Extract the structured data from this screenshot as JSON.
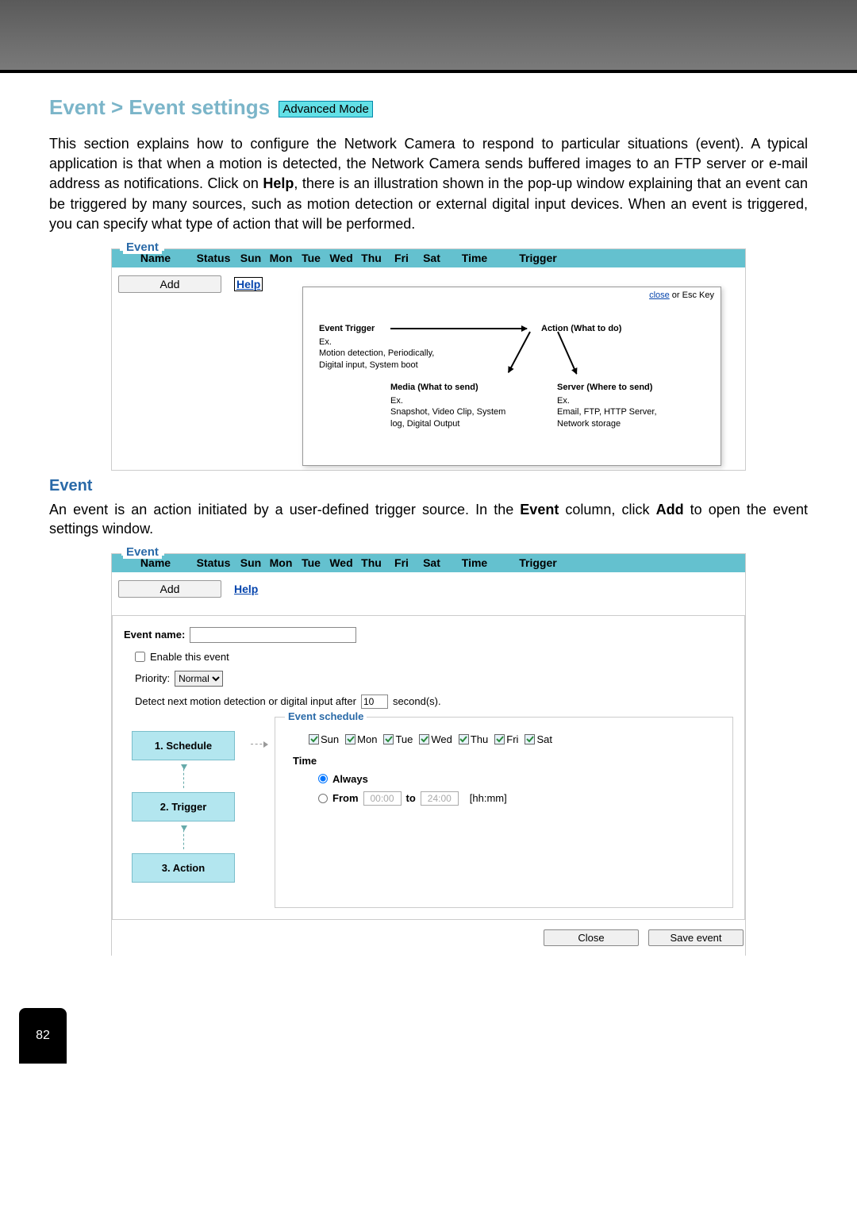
{
  "page_number": "82",
  "title_prefix": "Event > Event settings",
  "mode_badge": "Advanced Mode",
  "intro_paragraph": "This section explains how to configure the Network Camera to respond to particular situations (event). A typical application is that when a motion is detected, the Network Camera sends buffered images to an FTP server or e-mail address as notifications. Click on Help, there is an illustration shown in the pop-up window explaining that an event can be triggered by many sources, such as motion detection or external digital input devices. When an event is triggered, you can specify what type of action that will be performed.",
  "event_table": {
    "legend": "Event",
    "columns": [
      "Name",
      "Status",
      "Sun",
      "Mon",
      "Tue",
      "Wed",
      "Thu",
      "Fri",
      "Sat",
      "Time",
      "Trigger"
    ],
    "add_btn": "Add",
    "help_link": "Help"
  },
  "help_popup": {
    "close_text": "close",
    "close_suffix": " or Esc Key",
    "trigger_label": "Event Trigger",
    "trigger_ex": "Ex.\nMotion detection, Periodically,\nDigital input, System boot",
    "action_label": "Action (What to do)",
    "media_label": "Media (What to send)",
    "media_ex": "Ex.\nSnapshot, Video Clip, System\nlog, Digital Output",
    "server_label": "Server (Where to send)",
    "server_ex": "Ex.\nEmail, FTP, HTTP Server,\nNetwork storage"
  },
  "event_section_heading": "Event",
  "event_section_text": "An event is an action initiated by a user-defined trigger source. In the Event column, click Add to open the event settings window.",
  "settings": {
    "legend": "Event",
    "columns": [
      "Name",
      "Status",
      "Sun",
      "Mon",
      "Tue",
      "Wed",
      "Thu",
      "Fri",
      "Sat",
      "Time",
      "Trigger"
    ],
    "add_btn": "Add",
    "help_link": "Help",
    "event_name_label": "Event name:",
    "event_name_value": "",
    "enable_label": "Enable this event",
    "priority_label": "Priority:",
    "priority_value": "Normal",
    "detect_prefix": "Detect next motion detection or digital input after",
    "detect_value": "10",
    "detect_suffix": "second(s).",
    "steps": [
      "1.  Schedule",
      "2.  Trigger",
      "3.  Action"
    ],
    "schedule_legend": "Event schedule",
    "days": [
      "Sun",
      "Mon",
      "Tue",
      "Wed",
      "Thu",
      "Fri",
      "Sat"
    ],
    "time_label": "Time",
    "always_label": "Always",
    "from_label": "From",
    "from_value": "00:00",
    "to_label": "to",
    "to_value": "24:00",
    "hhmm_label": "[hh:mm]",
    "close_btn": "Close",
    "save_btn": "Save event"
  }
}
